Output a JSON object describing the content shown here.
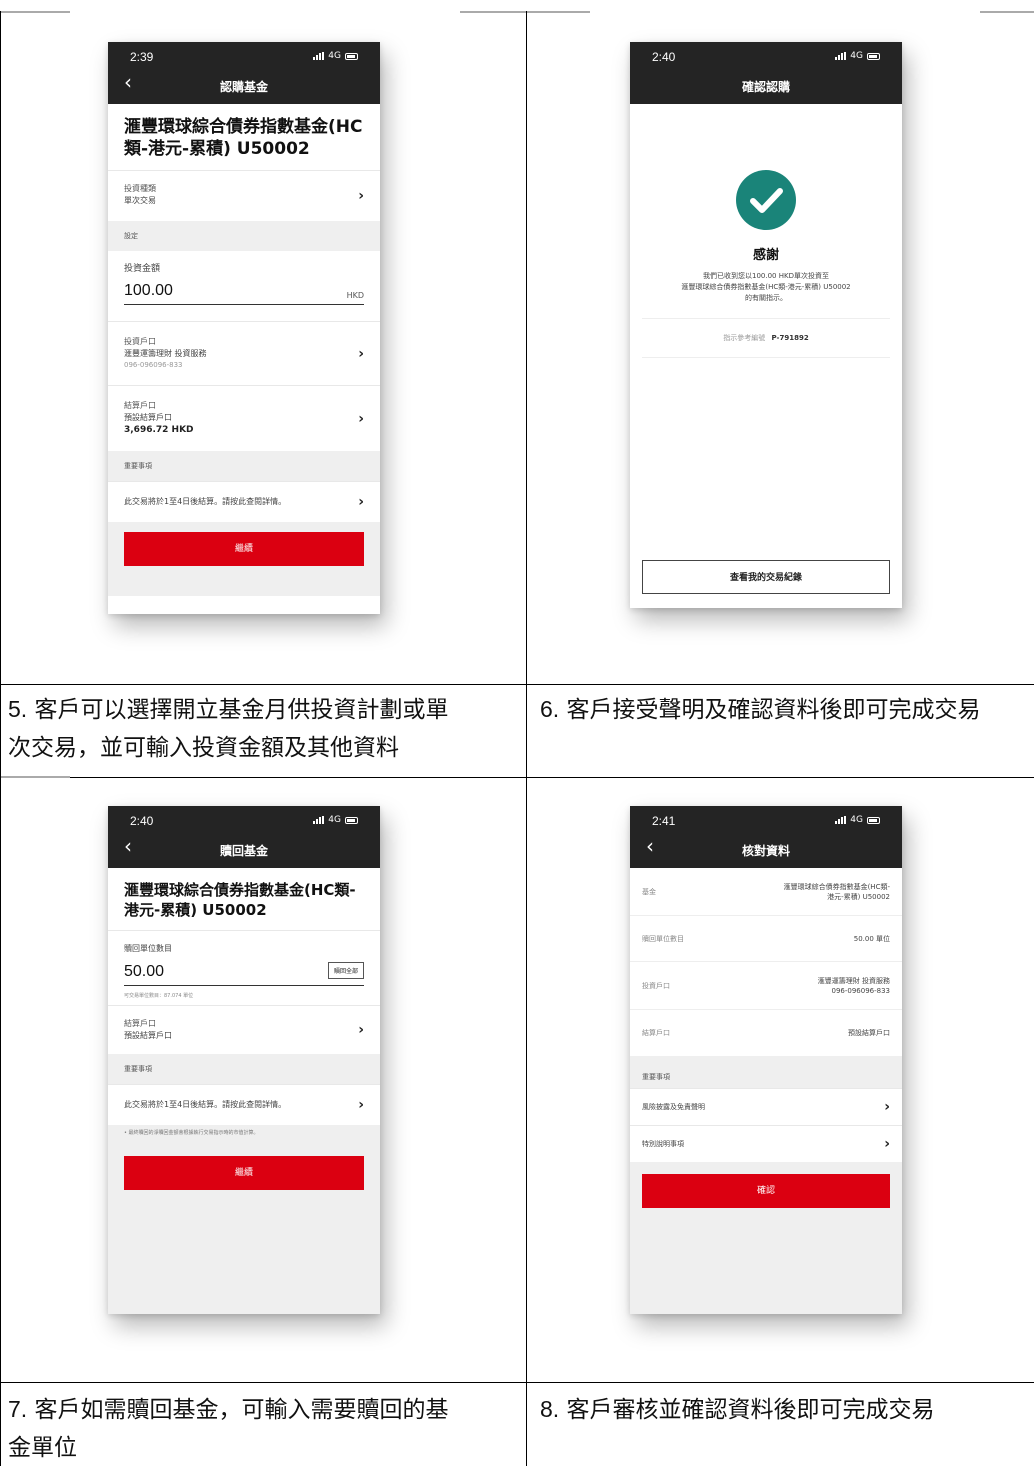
{
  "captions": {
    "c5_num": "5.",
    "c5_line1": " 客戶可以選擇開立基金月供投資計劃或單",
    "c5_line2": "次交易，並可輸入投資金額及其他資料",
    "c6_num": "6.",
    "c6_line1": " 客戶接受聲明及確認資料後即可完成交易",
    "c7_num": "7.",
    "c7_line1": " 客戶如需贖回基金，可輸入需要贖回的基",
    "c7_line2": "金單位",
    "c8_num": "8.",
    "c8_line1": " 客戶審核並確認資料後即可完成交易"
  },
  "status": {
    "network": "4G"
  },
  "phone1": {
    "time": "2:39",
    "title": "認購基金",
    "fund": "滙豐環球綜合債券指數基金(HC類-港元-累積) U50002",
    "inv_type_label": "投資種類",
    "inv_type_value": "單次交易",
    "settings_label": "設定",
    "amount_label": "投資金額",
    "amount_value": "100.00",
    "amount_unit": "HKD",
    "inv_acct_label": "投資戶口",
    "inv_acct_value": "滙豐運籌理財 投資服務",
    "inv_acct_no": "096-096096-833",
    "settle_label": "結算戶口",
    "settle_value": "預設結算戶口",
    "settle_balance": "3,696.72 HKD",
    "important_label": "重要事項",
    "important_text": "此交易將於1至4日後結算。請按此查閱詳情。",
    "continue": "繼續"
  },
  "phone2": {
    "time": "2:40",
    "title": "確認認購",
    "thanks": "感謝",
    "message_l1": "我們已收到您以100.00 HKD單次投資至",
    "message_l2": "滙豐環球綜合債券指數基金(HC類-港元-累積) U50002",
    "message_l3": "的有關指示。",
    "ref_label": "指示參考編號",
    "ref_value": "P-791892",
    "history_button": "查看我的交易紀錄"
  },
  "phone3": {
    "time": "2:40",
    "title": "贖回基金",
    "fund": "滙豐環球綜合債券指數基金(HC類-港元-累積) U50002",
    "units_label": "贖回單位數目",
    "units_value": "50.00",
    "redeem_all": "贖回全部",
    "available": "可交易單位數目：87.074 單位",
    "settle_label": "結算戶口",
    "settle_value": "預設結算戶口",
    "important_label": "重要事項",
    "important_text": "此交易將於1至4日後結算。請按此查閱詳情。",
    "note": "• 最終贖回的淨贖回金額會根據執行交易指示時的市值計算。",
    "continue": "繼續"
  },
  "phone4": {
    "time": "2:41",
    "title": "核對資料",
    "fund_label": "基金",
    "fund_value_l1": "滙豐環球綜合債券指數基金(HC類-",
    "fund_value_l2": "港元-累積) U50002",
    "units_label": "贖回單位數目",
    "units_value": "50.00 單位",
    "inv_acct_label": "投資戶口",
    "inv_acct_value_l1": "滙豐運籌理財 投資服務",
    "inv_acct_value_l2": "096-096096-833",
    "settle_label": "結算戶口",
    "settle_value": "預設結算戶口",
    "important_label": "重要事項",
    "risk_text": "風險披露及免責聲明",
    "special_text": "特別說明事項",
    "confirm": "確認"
  }
}
